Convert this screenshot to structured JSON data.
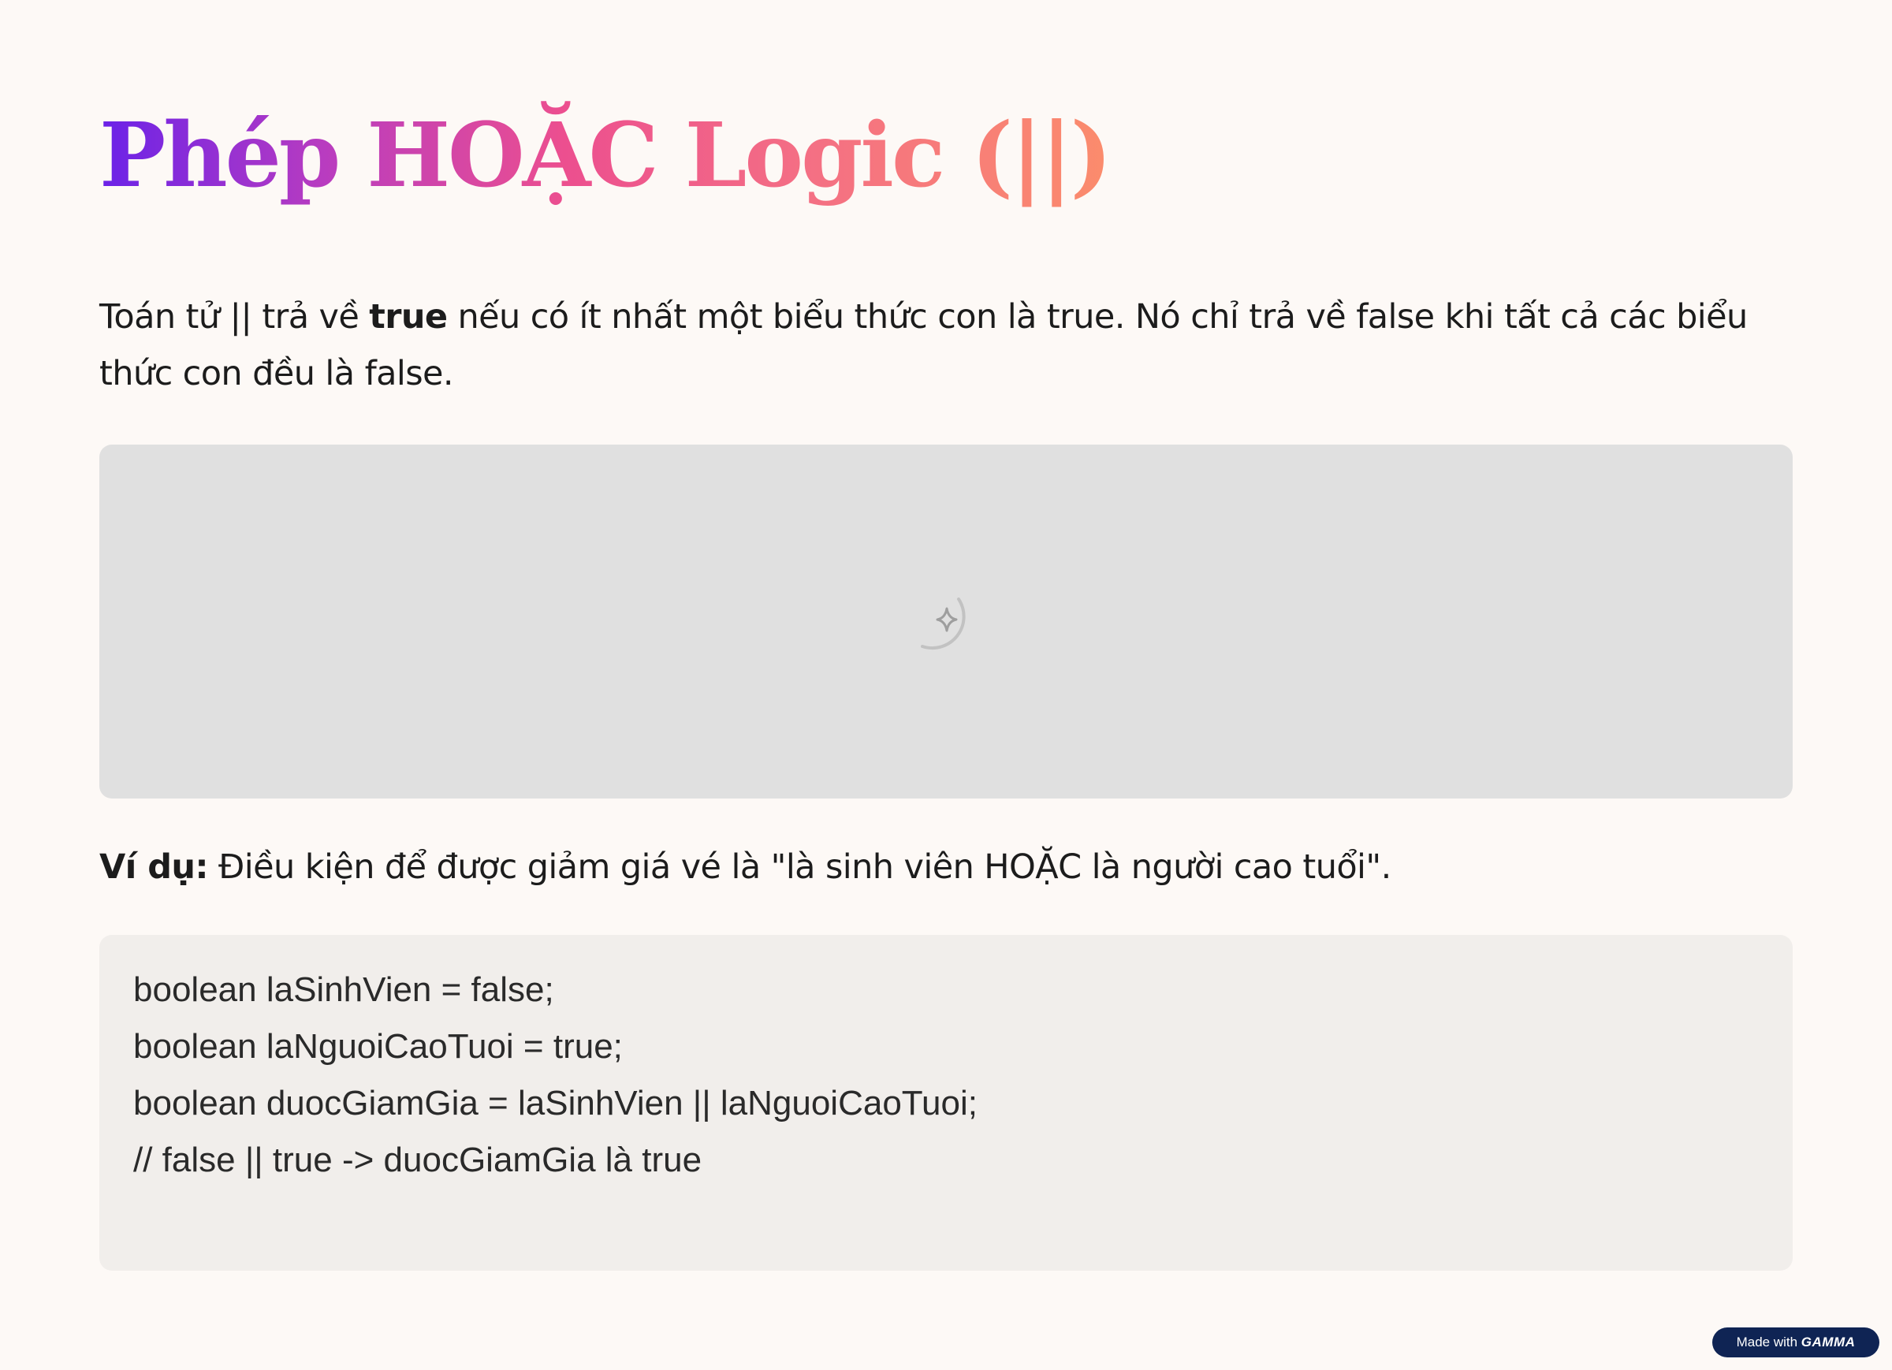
{
  "slide": {
    "title": "Phép HOẶC Logic (||)",
    "intro": {
      "before": "Toán tử || trả về ",
      "bold": "true",
      "after": " nếu có ít nhất một biểu thức con là true. Nó chỉ trả về false khi tất cả các biểu thức con đều là false."
    },
    "example": {
      "label": "Ví dụ:",
      "text": " Điều kiện để được giảm giá vé là \"là sinh viên HOẶC là người cao tuổi\"."
    },
    "code_lines": [
      "boolean laSinhVien = false;",
      "boolean laNguoiCaoTuoi = true;",
      "boolean duocGiamGia = laSinhVien || laNguoiCaoTuoi;",
      "// false || true -> duocGiamGia là true"
    ],
    "image_icon": "sparkle-loading-icon"
  },
  "badge": {
    "prefix": "Made with ",
    "brand": "GAMMA"
  },
  "colors": {
    "background": "#fdf9f6",
    "title_gradient_start": "#6a22e8",
    "title_gradient_mid": "#ec4f8f",
    "title_gradient_end": "#fb8c6c",
    "placeholder": "#e0e0e0",
    "code_background": "#f1eeeb",
    "badge_background": "#0f2454"
  }
}
